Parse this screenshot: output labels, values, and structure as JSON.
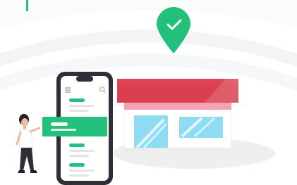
{
  "scene": {
    "description": "",
    "colors": {
      "brand_green": "#22c07a",
      "awning_red": "#d93f4f",
      "awning_pink": "#f2a3b3",
      "window_blue": "#8edcf2",
      "phone_dark": "#2f2f3a",
      "hair": "#1f1f26",
      "skin": "#f2b8a0"
    },
    "icons": [
      "location-pin-check-icon",
      "smartphone-icon",
      "menu-icon",
      "search-icon",
      "storefront-icon",
      "person-icon"
    ]
  }
}
